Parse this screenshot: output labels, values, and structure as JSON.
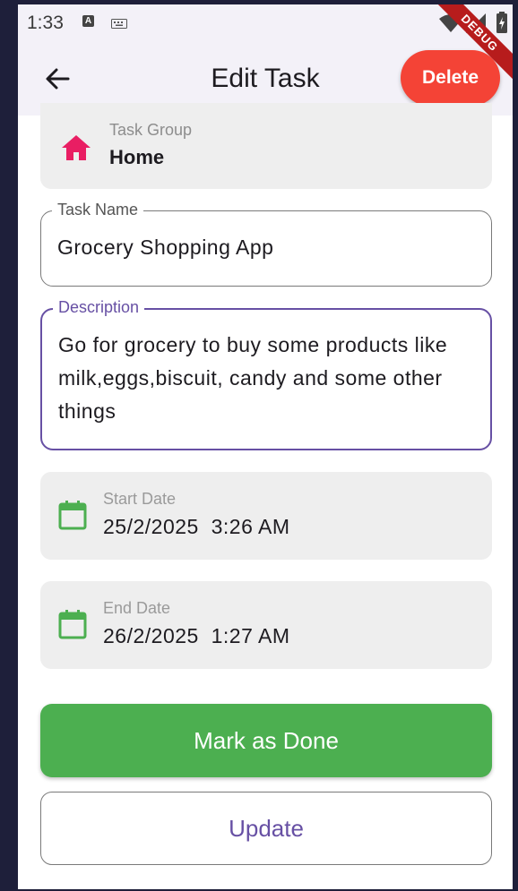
{
  "status_bar": {
    "time": "1:33",
    "notification_icon_letter": "A",
    "icons": [
      "a-notification-icon",
      "keyboard-icon",
      "wifi-icon",
      "cell-signal-icon",
      "battery-icon"
    ]
  },
  "debug_banner": "DEBUG",
  "app_bar": {
    "back_icon": "arrow-left-icon",
    "title": "Edit Task",
    "delete_label": "Delete"
  },
  "task_group": {
    "label": "Task Group",
    "value": "Home",
    "icon": "home-icon"
  },
  "task_name": {
    "label": "Task Name",
    "value": "Grocery Shopping App"
  },
  "description": {
    "label": "Description",
    "value": "Go for grocery to buy some products like milk,eggs,biscuit, candy and some other things"
  },
  "start_date": {
    "label": "Start Date",
    "value": "25/2/2025  3:26 AM",
    "icon": "calendar-icon"
  },
  "end_date": {
    "label": "End Date",
    "value": "26/2/2025  1:27 AM",
    "icon": "calendar-icon"
  },
  "actions": {
    "mark_done_label": "Mark as Done",
    "update_label": "Update"
  },
  "colors": {
    "accent": "#6750a4",
    "delete": "#f44336",
    "done": "#4caf50",
    "home_icon": "#e91e63",
    "calendar_icon": "#4caf50"
  }
}
